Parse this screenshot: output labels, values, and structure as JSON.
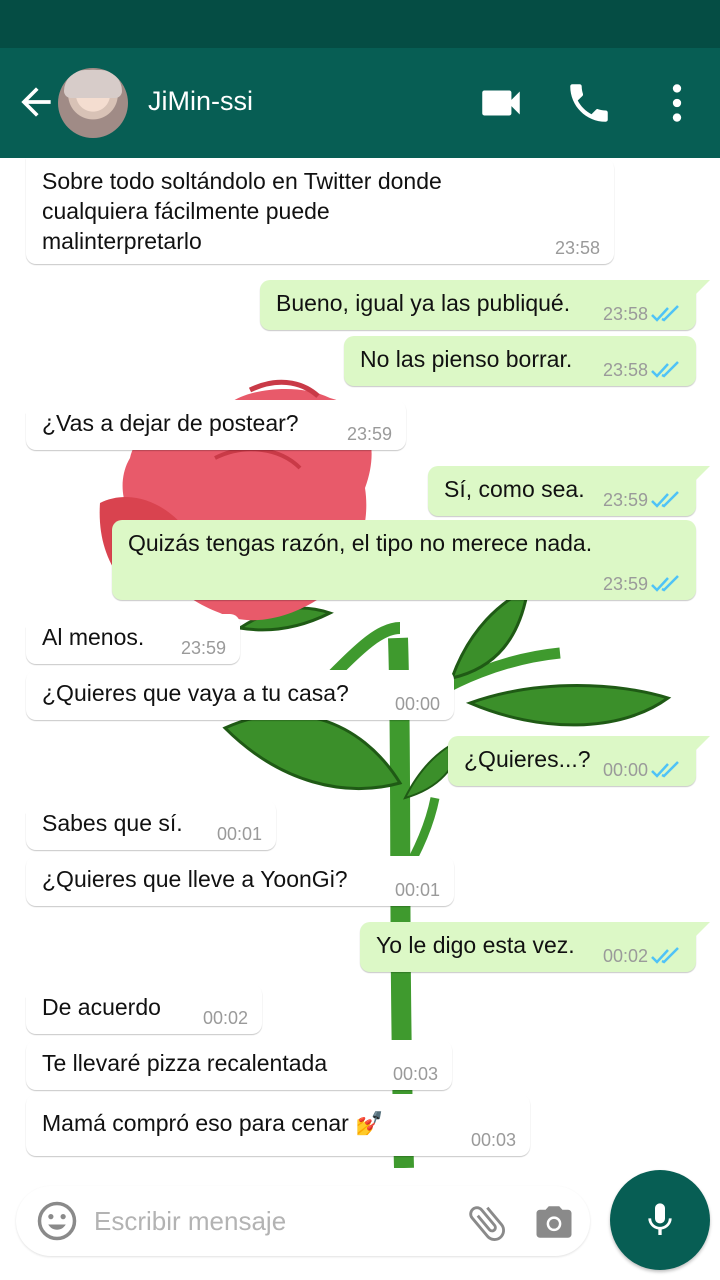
{
  "header": {
    "contact_name": "JiMin-ssi",
    "icons": [
      "back-arrow-icon",
      "video-call-icon",
      "phone-icon",
      "more-vert-icon"
    ]
  },
  "messages": [
    {
      "direction": "in",
      "text": "Sobre todo soltándolo en Twitter donde cualquiera fácilmente puede malinterpretarlo",
      "time": "23:58"
    },
    {
      "direction": "out",
      "text": "Bueno, igual ya las publiqué.",
      "time": "23:58",
      "read": true
    },
    {
      "direction": "out",
      "text": "No las pienso borrar.",
      "time": "23:58",
      "read": true
    },
    {
      "direction": "in",
      "text": "¿Vas a dejar de postear?",
      "time": "23:59"
    },
    {
      "direction": "out",
      "text": "Sí, como sea.",
      "time": "23:59",
      "read": true
    },
    {
      "direction": "out",
      "text": "Quizás tengas razón, el tipo no merece nada.",
      "time": "23:59",
      "read": true
    },
    {
      "direction": "in",
      "text": "Al menos.",
      "time": "23:59"
    },
    {
      "direction": "in",
      "text": "¿Quieres que vaya a tu casa?",
      "time": "00:00"
    },
    {
      "direction": "out",
      "text": "¿Quieres...?",
      "time": "00:00",
      "read": true
    },
    {
      "direction": "in",
      "text": "Sabes que sí.",
      "time": "00:01"
    },
    {
      "direction": "in",
      "text": "¿Quieres que lleve a YoonGi?",
      "time": "00:01"
    },
    {
      "direction": "out",
      "text": "Yo le digo esta vez.",
      "time": "00:02",
      "read": true
    },
    {
      "direction": "in",
      "text": "De acuerdo",
      "time": "00:02"
    },
    {
      "direction": "in",
      "text": "Te llevaré pizza recalentada",
      "time": "00:03"
    },
    {
      "direction": "in",
      "text": "Mamá compró eso para cenar 💅",
      "time": "00:03"
    }
  ],
  "composer": {
    "placeholder": "Escribir mensaje",
    "icons": [
      "emoji-icon",
      "attach-icon",
      "camera-icon",
      "mic-icon"
    ]
  },
  "colors": {
    "header": "#075e54",
    "statusbar": "#054d44",
    "outgoing_bubble": "#dcf8c6",
    "incoming_bubble": "#ffffff",
    "read_ticks": "#4fc3f7"
  }
}
